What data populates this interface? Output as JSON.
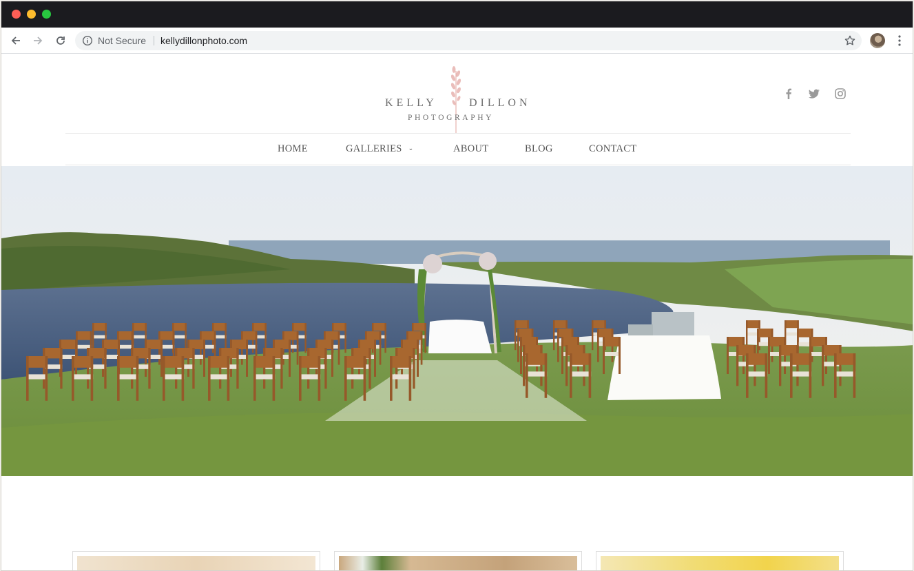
{
  "browser": {
    "status": "Not Secure",
    "url": "kellydillonphoto.com",
    "icons": {
      "back": "back-arrow-icon",
      "forward": "forward-arrow-icon",
      "reload": "reload-icon",
      "info": "info-icon",
      "bookmark": "star-icon",
      "profile": "avatar",
      "menu": "kebab-menu-icon"
    }
  },
  "site": {
    "logo": {
      "line1_left": "KELLY",
      "line1_right": "DILLON",
      "line2": "PHOTOGRAPHY",
      "accent_color": "#e7b2ae"
    },
    "social": [
      "facebook-icon",
      "twitter-icon",
      "instagram-icon"
    ],
    "nav": {
      "items": [
        {
          "label": "HOME"
        },
        {
          "label": "GALLERIES",
          "has_dropdown": true
        },
        {
          "label": "ABOUT"
        },
        {
          "label": "BLOG"
        },
        {
          "label": "CONTACT"
        }
      ]
    },
    "hero": {
      "alt_scene": "wedding-ceremony-photo"
    },
    "cards": [
      "gallery-card-1",
      "gallery-card-2",
      "gallery-card-3"
    ]
  },
  "colors": {
    "titlebar": "#1b1b1f",
    "nav_text": "#555555",
    "icon_gray": "#9a9a9a"
  }
}
